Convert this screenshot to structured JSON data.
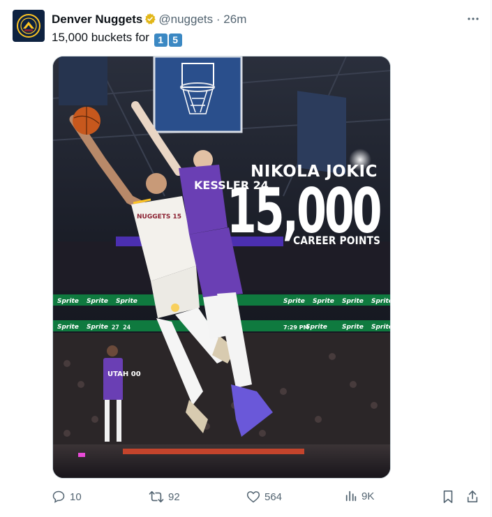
{
  "author": {
    "name": "Denver Nuggets",
    "handle": "@nuggets",
    "separator": "·",
    "time": "26m"
  },
  "tweet": {
    "text": "15,000 buckets for ",
    "emoji_keys": [
      "1",
      "5"
    ]
  },
  "media": {
    "player_name": "NIKOLA JOKIC",
    "points": "15,000",
    "caption": "CAREER POINTS",
    "jersey_white": "NUGGETS 15",
    "jersey_purple": "KESSLER 24",
    "bg_jersey": "UTAH 00",
    "signage": "Sprite",
    "scoreboard": "27  24",
    "clock": "7:29 PM"
  },
  "actions": {
    "replies": "10",
    "reposts": "92",
    "likes": "564",
    "views": "9K"
  },
  "colors": {
    "verified": "#e2b719",
    "key_bg": "#3b88c3",
    "muted": "#536471",
    "jazz_purple": "#6a3fb4",
    "nuggets_navy": "#0e2240"
  }
}
